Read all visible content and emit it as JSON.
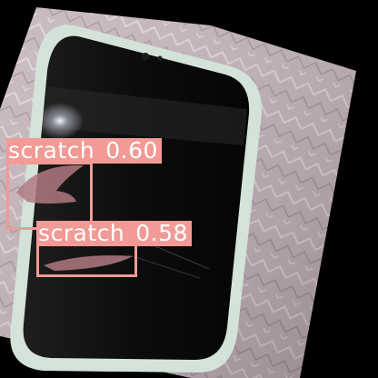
{
  "detections": [
    {
      "class_label": "scratch",
      "confidence": "0.60"
    },
    {
      "class_label": "scratch",
      "confidence": "0.58"
    }
  ],
  "colors": {
    "box_color": "#f29a95",
    "label_text_color": "#ffffff",
    "background": "#000000",
    "fabric": "#c9b7bf",
    "phone_frame": "#cfe0d6",
    "screen": "#0a0a0a"
  }
}
